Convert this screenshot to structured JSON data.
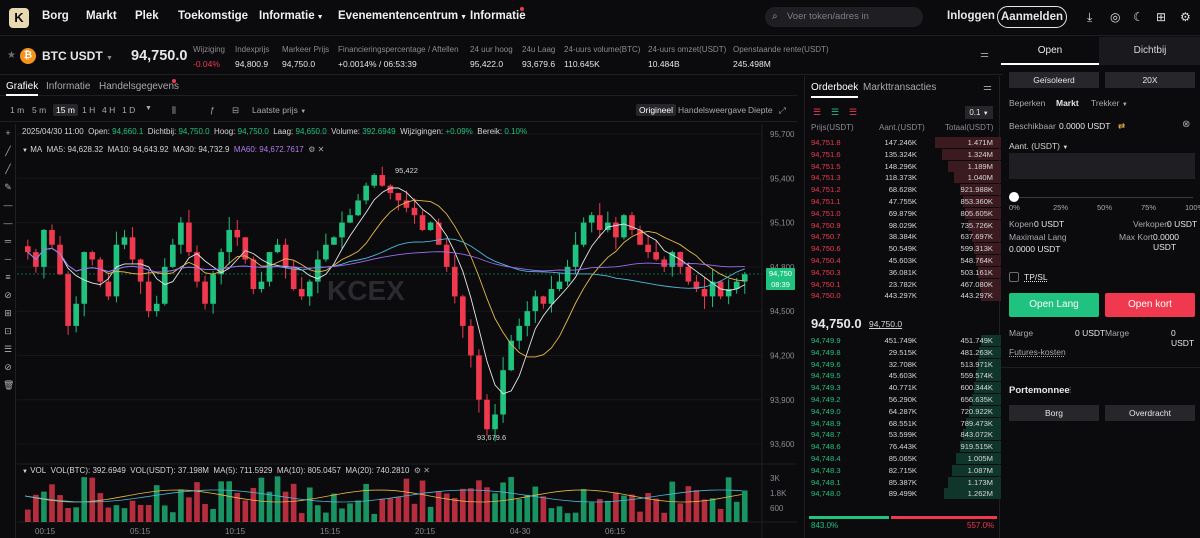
{
  "nav": {
    "items": [
      "Borg",
      "Markt",
      "Plek",
      "Toekomstige",
      "Informatie",
      "Evenementencentrum",
      "Informatie"
    ],
    "search_placeholder": "Voer token/adres in",
    "login": "Inloggen",
    "register": "Aanmelden",
    "logo": "K"
  },
  "ticker": {
    "symbol": "BTC USDT",
    "price": "94,750.0",
    "stats": [
      {
        "label": "Wijziging",
        "value": "-0.04%",
        "neg": true
      },
      {
        "label": "Indexprijs",
        "value": "94,800.9"
      },
      {
        "label": "Markeer Prijs",
        "value": "94,750.0"
      },
      {
        "label": "Financieringspercentage / Aftellen",
        "value": "+0.0014% / 06:53:39"
      },
      {
        "label": "24 uur hoog",
        "value": "95,422.0"
      },
      {
        "label": "24u Laag",
        "value": "93,679.6"
      },
      {
        "label": "24-uurs volume(BTC)",
        "value": "110.645K"
      },
      {
        "label": "24-uurs omzet(USDT)",
        "value": "10.484B"
      },
      {
        "label": "Openstaande rente(USDT)",
        "value": "245.498M"
      }
    ]
  },
  "chart_tabs": [
    "Grafiek",
    "Informatie",
    "Handelsgegevens"
  ],
  "intervals": [
    "1 m",
    "5 m",
    "15 m",
    "1 H",
    "4 H",
    "1 D"
  ],
  "price_type": "Laatste prijs",
  "views": [
    "Origineel",
    "Handelsweergave",
    "Diepte"
  ],
  "ohlc": {
    "date": "2025/04/30 11:00",
    "open_l": "Open:",
    "open": "94,660.1",
    "close_l": "Dichtbij:",
    "close": "94,750.0",
    "high_l": "Hoog:",
    "high": "94,750.0",
    "low_l": "Laag:",
    "low": "94,650.0",
    "vol_l": "Volume:",
    "vol": "392.6949",
    "chg_l": "Wijzigingen:",
    "chg": "+0.09%",
    "rng_l": "Bereik:",
    "rng": "0.10%"
  },
  "ma": {
    "label": "MA",
    "ma5": "MA5: 94,628.32",
    "ma10": "MA10: 94,643.92",
    "ma30": "MA30: 94,732.9",
    "ma60": "MA60: 94,672.7617"
  },
  "vol": {
    "label": "VOL",
    "btc": "VOL(BTC): 392.6949",
    "usdt": "VOL(USDT): 37.198M",
    "ma5": "MA(5): 711.5929",
    "ma10": "MA(10): 805.0457",
    "ma20": "MA(20): 740.2810"
  },
  "watermark": "KCEX",
  "chart_data": {
    "type": "candlestick",
    "title": "",
    "y_ticks": [
      "95,700",
      "95,400",
      "95,100",
      "94,800",
      "94,500",
      "94,200",
      "93,900",
      "93,600"
    ],
    "vol_ticks": [
      "3K",
      "1.8K",
      "600"
    ],
    "x_ticks": [
      "00:15",
      "05:15",
      "10:15",
      "15:15",
      "20:15",
      "04-30",
      "06:15"
    ],
    "high_label": "95,422",
    "low_label": "93,679.6",
    "last_price": "94,750",
    "countdown": "08:39"
  },
  "orderbook": {
    "tabs": [
      "Orderboek",
      "Markttransacties"
    ],
    "precision": "0.1",
    "headers": [
      "Prijs(USDT)",
      "Aant.(USDT)",
      "Totaal(USDT)"
    ],
    "asks": [
      [
        "94,751.8",
        "147.246K",
        "1.471M"
      ],
      [
        "94,751.6",
        "135.324K",
        "1.324M"
      ],
      [
        "94,751.5",
        "148.296K",
        "1.189M"
      ],
      [
        "94,751.3",
        "118.373K",
        "1.040M"
      ],
      [
        "94,751.2",
        "68.628K",
        "921.988K"
      ],
      [
        "94,751.1",
        "47.755K",
        "853.360K"
      ],
      [
        "94,751.0",
        "69.879K",
        "805.605K"
      ],
      [
        "94,750.9",
        "98.029K",
        "735.726K"
      ],
      [
        "94,750.7",
        "38.384K",
        "637.697K"
      ],
      [
        "94,750.6",
        "50.549K",
        "599.313K"
      ],
      [
        "94,750.4",
        "45.603K",
        "548.764K"
      ],
      [
        "94,750.3",
        "36.081K",
        "503.161K"
      ],
      [
        "94,750.1",
        "23.782K",
        "467.080K"
      ],
      [
        "94,750.0",
        "443.297K",
        "443.297K"
      ]
    ],
    "mid": "94,750.0",
    "mid2": "94,750.0",
    "bids": [
      [
        "94,749.9",
        "451.749K",
        "451.749K"
      ],
      [
        "94,749.8",
        "29.515K",
        "481.263K"
      ],
      [
        "94,749.6",
        "32.708K",
        "513.971K"
      ],
      [
        "94,749.5",
        "45.603K",
        "559.574K"
      ],
      [
        "94,749.3",
        "40.771K",
        "600.344K"
      ],
      [
        "94,749.2",
        "56.290K",
        "656.635K"
      ],
      [
        "94,749.0",
        "64.287K",
        "720.922K"
      ],
      [
        "94,748.9",
        "68.551K",
        "789.473K"
      ],
      [
        "94,748.7",
        "53.599K",
        "843.072K"
      ],
      [
        "94,748.6",
        "76.443K",
        "919.515K"
      ],
      [
        "94,748.4",
        "85.065K",
        "1.005M"
      ],
      [
        "94,748.3",
        "82.715K",
        "1.087M"
      ],
      [
        "94,748.1",
        "85.387K",
        "1.173M"
      ],
      [
        "94,748.0",
        "89.499K",
        "1.262M"
      ]
    ],
    "buy_pct": "843.0%",
    "sell_pct": "557.0%"
  },
  "trade": {
    "tabs": [
      "Open",
      "Dichtbij"
    ],
    "margin_mode": "Geïsoleerd",
    "leverage": "20X",
    "order_types": [
      "Beperken",
      "Markt",
      "Trekker"
    ],
    "available_l": "Beschikbaar",
    "available": "0.0000 USDT",
    "qty_l": "Aant. (USDT)",
    "slider": [
      "0%",
      "25%",
      "50%",
      "75%",
      "100%"
    ],
    "buy_l": "Kopen",
    "buy_v": "0 USDT",
    "sell_l": "Verkopen",
    "sell_v": "0 USDT",
    "maxlong_l": "Maximaal Lang",
    "maxlong_v": "0.0000 USDT",
    "maxshort_l": "Max Kort",
    "maxshort_v": "0.0000 USDT",
    "tpsl": "TP/SL",
    "open_long": "Open Lang",
    "open_short": "Open kort",
    "margin_l": "Marge",
    "margin_v": "0 USDT",
    "margin2_l": "Marge",
    "margin2_v": "0 USDT",
    "futures_cost": "Futures-kosten",
    "wallet": "Portemonnee",
    "borg": "Borg",
    "transfer": "Overdracht"
  }
}
